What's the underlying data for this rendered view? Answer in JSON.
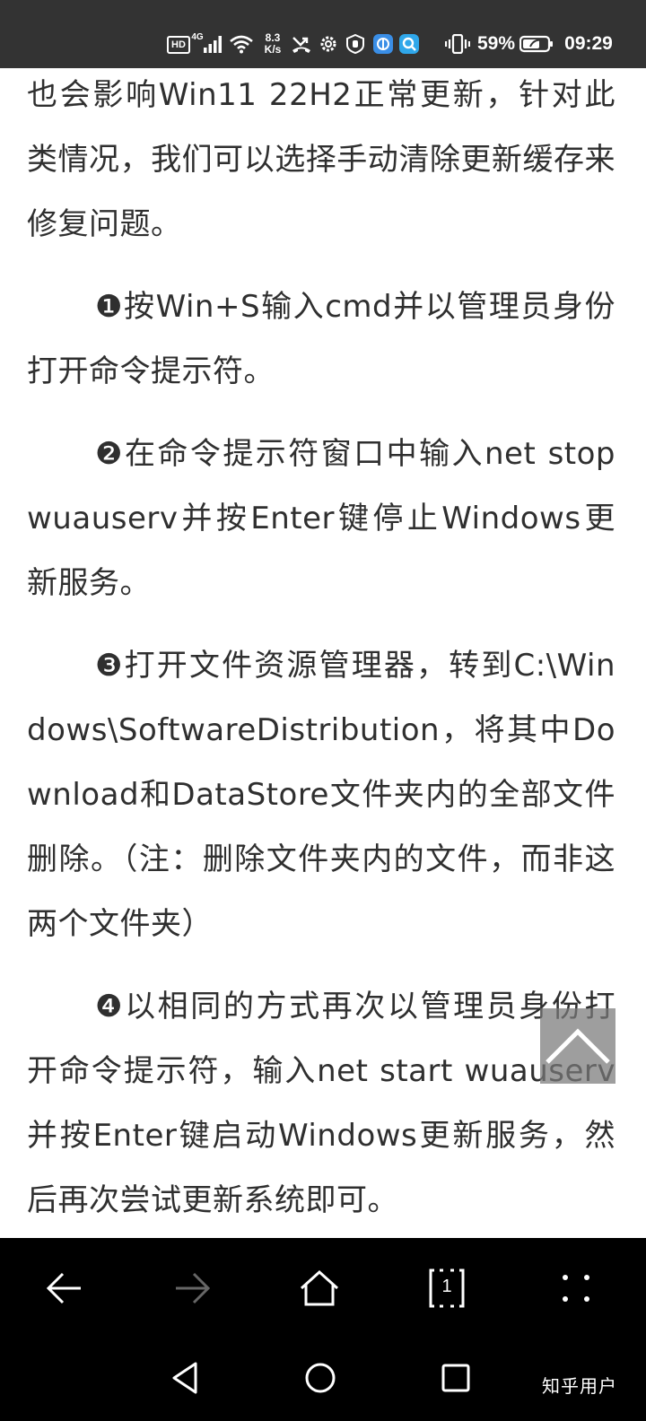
{
  "status_bar": {
    "hd": "HD",
    "network": "4G",
    "speed_value": "8.3",
    "speed_unit": "K/s",
    "battery_percent": "59%",
    "time": "09:29",
    "icons": [
      "signal-icon",
      "wifi-icon",
      "missed-call-icon",
      "gear-icon",
      "hand-icon",
      "app-icon",
      "search-app-icon",
      "vibrate-icon",
      "battery-icon"
    ]
  },
  "article": {
    "paragraphs": [
      "也会影响Win11 22H2正常更新，针对此类情况，我们可以选择手动清除更新缓存来修复问题。",
      "❶按Win+S输入cmd并以管理员身份打开命令提示符。",
      "❷在命令提示符窗口中输入net stop wuauserv并按Enter键停止Windows更新服务。",
      "❸打开文件资源管理器，转到C:\\Windows\\SoftwareDistribution，将其中Download和DataStore文件夹内的全部文件删除。（注：删除文件夹内的文件，而非这两个文件夹）",
      "❹以相同的方式再次以管理员身份打开命令提示符，输入net start wuauserv并按Enter键启动Windows更新服务，然后再次尝试更新系统即可。"
    ]
  },
  "browser_toolbar": {
    "tab_count": "1",
    "icons": [
      "back-arrow-icon",
      "forward-arrow-icon",
      "home-icon",
      "tabs-icon",
      "more-icon"
    ]
  },
  "system_nav": {
    "icons": [
      "nav-back-icon",
      "nav-home-icon",
      "nav-recents-icon"
    ]
  },
  "watermark": "知乎用户",
  "colors": {
    "status_bar_bg": "#333333",
    "text": "#2f2f2f",
    "toolbar_bg": "#000000",
    "back_to_top_bg": "#787878"
  }
}
